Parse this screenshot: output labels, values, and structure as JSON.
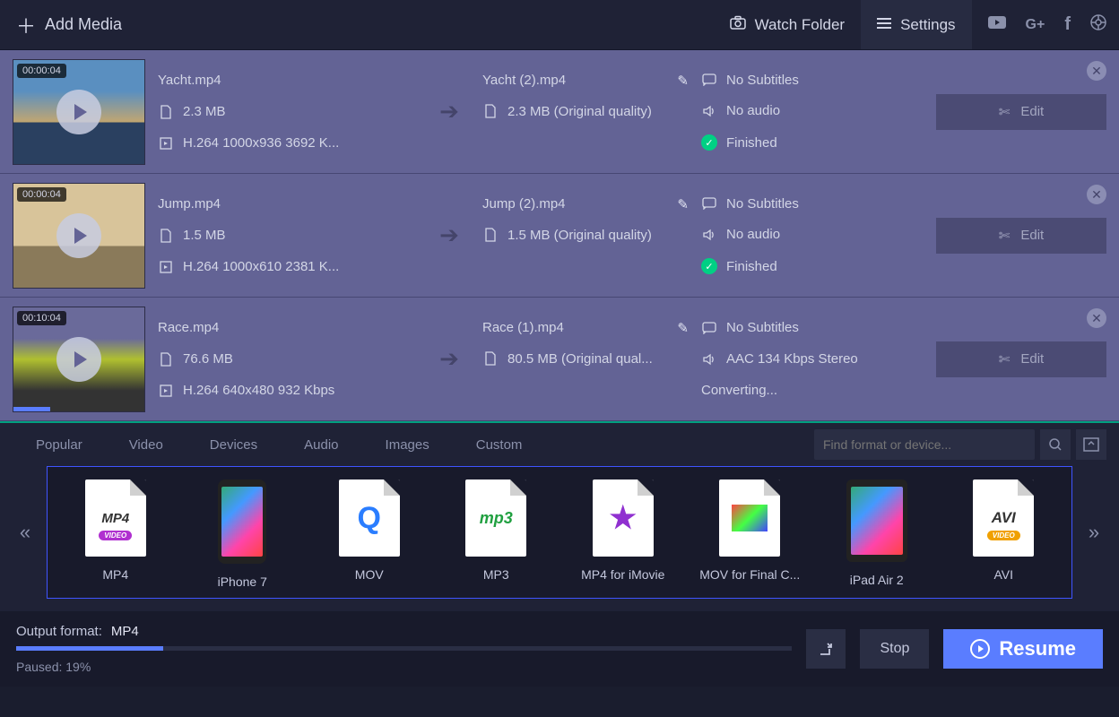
{
  "topbar": {
    "add_media": "Add Media",
    "watch_folder": "Watch Folder",
    "settings": "Settings"
  },
  "files": [
    {
      "duration": "00:00:04",
      "src_name": "Yacht.mp4",
      "src_size": "2.3 MB",
      "src_codec": "H.264 1000x936 3692 K...",
      "dst_name": "Yacht (2).mp4",
      "dst_size": "2.3 MB (Original quality)",
      "subtitles": "No Subtitles",
      "audio": "No audio",
      "status": "Finished",
      "finished": true,
      "edit_label": "Edit"
    },
    {
      "duration": "00:00:04",
      "src_name": "Jump.mp4",
      "src_size": "1.5 MB",
      "src_codec": "H.264 1000x610 2381 K...",
      "dst_name": "Jump (2).mp4",
      "dst_size": "1.5 MB (Original quality)",
      "subtitles": "No Subtitles",
      "audio": "No audio",
      "status": "Finished",
      "finished": true,
      "edit_label": "Edit"
    },
    {
      "duration": "00:10:04",
      "src_name": "Race.mp4",
      "src_size": "76.6 MB",
      "src_codec": "H.264 640x480 932 Kbps",
      "dst_name": "Race (1).mp4",
      "dst_size": "80.5 MB (Original qual...",
      "subtitles": "No Subtitles",
      "audio": "AAC 134 Kbps Stereo",
      "status": "Converting...",
      "finished": false,
      "edit_label": "Edit"
    }
  ],
  "format_tabs": [
    "Popular",
    "Video",
    "Devices",
    "Audio",
    "Images",
    "Custom"
  ],
  "search_placeholder": "Find format or device...",
  "formats": [
    "MP4",
    "iPhone 7",
    "MOV",
    "MP3",
    "MP4 for iMovie",
    "MOV for Final C...",
    "iPad Air 2",
    "AVI"
  ],
  "footer": {
    "output_label": "Output format:",
    "output_value": "MP4",
    "paused_label": "Paused:",
    "paused_value": "19%",
    "stop": "Stop",
    "resume": "Resume"
  }
}
